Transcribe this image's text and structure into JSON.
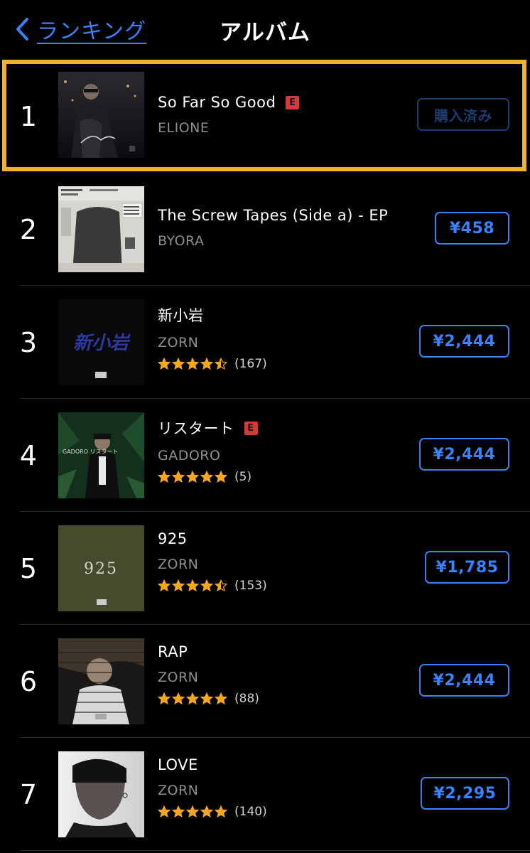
{
  "nav": {
    "back_label": "ランキング",
    "title": "アルバム"
  },
  "albums": [
    {
      "rank": "1",
      "title": "So Far So Good",
      "explicit": true,
      "artist": "ELIONE",
      "has_rating": false,
      "rating_stars": 0,
      "rating_count": "",
      "button": "購入済み",
      "purchased": true,
      "highlighted": true
    },
    {
      "rank": "2",
      "title": "The Screw Tapes (Side a) - EP",
      "explicit": false,
      "artist": "BYORA",
      "has_rating": false,
      "rating_stars": 0,
      "rating_count": "",
      "button": "¥458",
      "purchased": false,
      "highlighted": false
    },
    {
      "rank": "3",
      "title": "新小岩",
      "explicit": false,
      "artist": "ZORN",
      "has_rating": true,
      "rating_stars": 4.5,
      "rating_count": "(167)",
      "button": "¥2,444",
      "purchased": false,
      "highlighted": false,
      "art_text": "新小岩"
    },
    {
      "rank": "4",
      "title": "リスタート",
      "explicit": true,
      "artist": "GADORO",
      "has_rating": true,
      "rating_stars": 5,
      "rating_count": "(5)",
      "button": "¥2,444",
      "purchased": false,
      "highlighted": false,
      "art_text": "GADORO リスタート"
    },
    {
      "rank": "5",
      "title": "925",
      "explicit": false,
      "artist": "ZORN",
      "has_rating": true,
      "rating_stars": 4.5,
      "rating_count": "(153)",
      "button": "¥1,785",
      "purchased": false,
      "highlighted": false,
      "art_text": "925"
    },
    {
      "rank": "6",
      "title": "RAP",
      "explicit": false,
      "artist": "ZORN",
      "has_rating": true,
      "rating_stars": 5,
      "rating_count": "(88)",
      "button": "¥2,444",
      "purchased": false,
      "highlighted": false
    },
    {
      "rank": "7",
      "title": "LOVE",
      "explicit": false,
      "artist": "ZORN",
      "has_rating": true,
      "rating_stars": 5,
      "rating_count": "(140)",
      "button": "¥2,295",
      "purchased": false,
      "highlighted": false
    }
  ],
  "explicit_label": "E",
  "colors": {
    "accent": "#3b82f6",
    "highlight": "#f0b030",
    "star": "#f5a623",
    "explicit": "#d23b3b"
  }
}
